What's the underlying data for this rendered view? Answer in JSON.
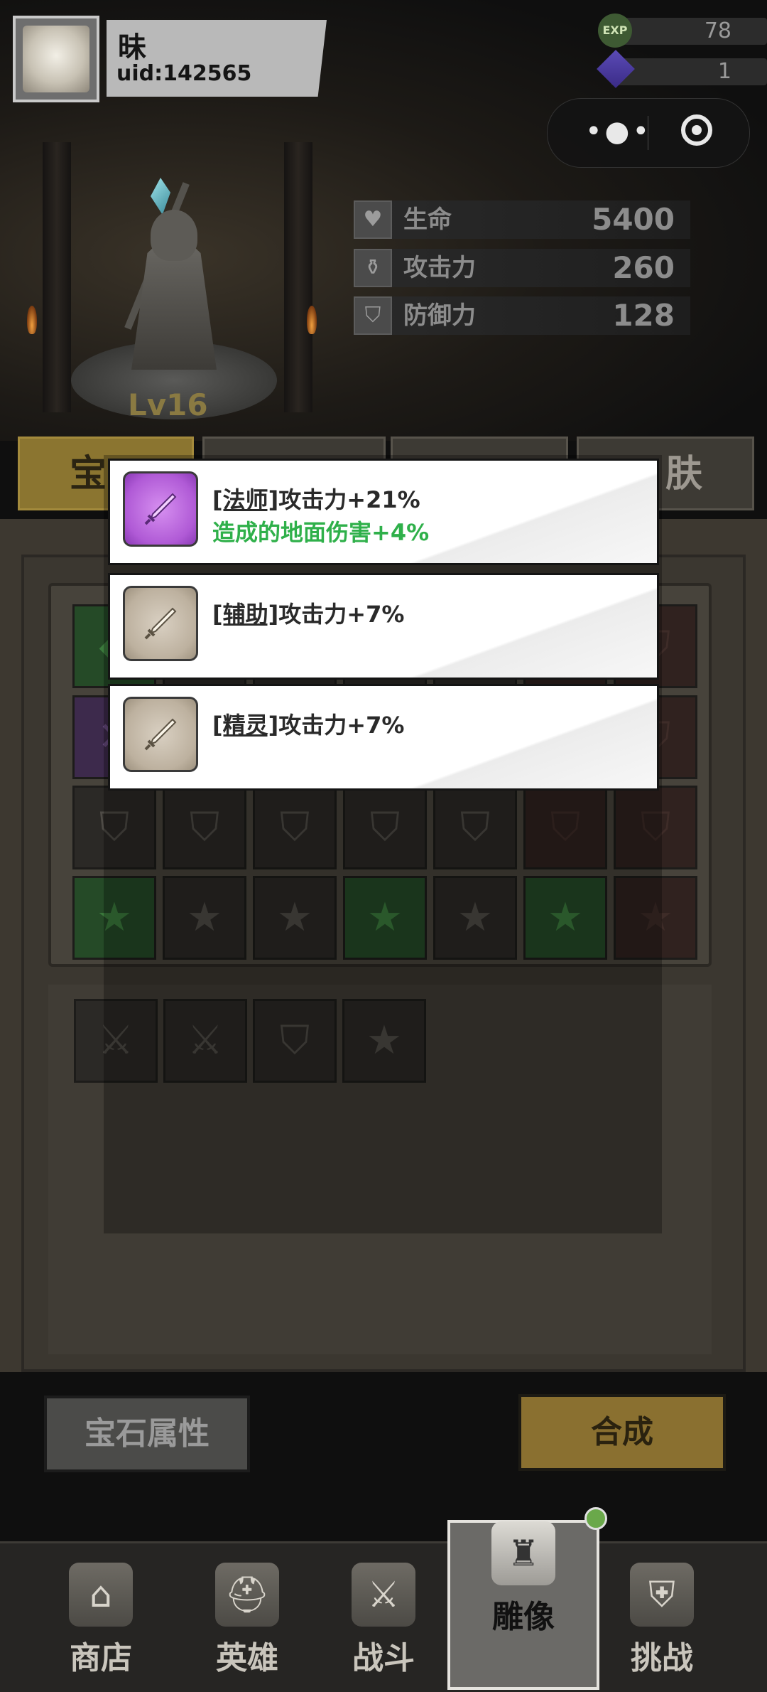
{
  "player": {
    "name": "昧",
    "uid": "uid:142565"
  },
  "resources": {
    "exp": "78",
    "gems": "1"
  },
  "capsule": {
    "more": "•●•",
    "close": ""
  },
  "statue": {
    "level": "Lv16"
  },
  "stats": [
    {
      "label": "生命",
      "value": "5400",
      "icon": "heart-icon"
    },
    {
      "label": "攻击力",
      "value": "260",
      "icon": "potion-icon"
    },
    {
      "label": "防御力",
      "value": "128",
      "icon": "shield-icon"
    }
  ],
  "tabs": [
    {
      "label": "宝",
      "active": true
    },
    {
      "label": "",
      "active": false
    },
    {
      "label": "",
      "active": false
    },
    {
      "label": "肤",
      "active": false
    }
  ],
  "popup": [
    {
      "tag": "[法师]",
      "effect": "攻击力+21%",
      "bonus": "造成的地面伤害+4%",
      "rarity": "purple"
    },
    {
      "tag": "[辅助]",
      "effect": "攻击力+7%",
      "bonus": "",
      "rarity": "beige"
    },
    {
      "tag": "[精灵]",
      "effect": "攻击力+7%",
      "bonus": "",
      "rarity": "beige"
    }
  ],
  "buttons": {
    "gem_attributes": "宝石属性",
    "synthesize": "合成"
  },
  "nav": [
    {
      "label": "商店",
      "icon": "shop-icon"
    },
    {
      "label": "英雄",
      "icon": "helmet-icon"
    },
    {
      "label": "战斗",
      "icon": "crossed-swords-icon"
    },
    {
      "label": "雕像",
      "icon": "statue-icon",
      "active": true
    },
    {
      "label": "挑战",
      "icon": "challenge-shield-icon"
    }
  ],
  "colors": {
    "gold_accent": "#8b7530",
    "green_text": "#2fb04a",
    "purple_gem": "#b05ad6"
  }
}
